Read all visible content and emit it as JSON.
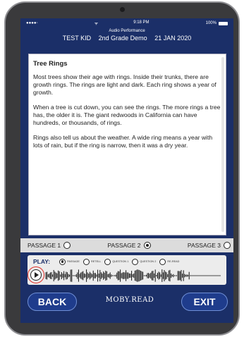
{
  "status_bar": {
    "signal": "●●●●◦",
    "wifi": "ᯤ",
    "time": "9:18 PM",
    "battery_pct": "100%"
  },
  "header": {
    "subtitle": "Audio Performance",
    "student": "TEST KID",
    "demo": "2nd Grade Demo",
    "date": "21 JAN 2020"
  },
  "passage": {
    "title": "Tree Rings",
    "paragraphs": [
      "Most trees show their age with rings. Inside their trunks, there are growth rings. The rings are light and dark. Each ring shows a year of growth.",
      "When a tree is cut down, you can see the rings. The more rings a tree has, the older it is. The giant redwoods in California can have hundreds, or thousands, of rings.",
      "Rings also tell us about the weather. A wide ring means a year with lots of rain, but if the ring is narrow, then it was a dry year."
    ]
  },
  "passage_selector": [
    {
      "label": "PASSAGE 1",
      "selected": false
    },
    {
      "label": "PASSAGE 2",
      "selected": true
    },
    {
      "label": "PASSAGE 3",
      "selected": false
    }
  ],
  "play": {
    "label": "PLAY:",
    "options": [
      {
        "label": "PASSAGE",
        "selected": true
      },
      {
        "label": "RETELL",
        "selected": false
      },
      {
        "label": "QUESTION 1",
        "selected": false
      },
      {
        "label": "QUESTION 2",
        "selected": false
      },
      {
        "label": "RE-READ",
        "selected": false
      }
    ]
  },
  "footer": {
    "back_label": "BACK",
    "logo_text": "MOBY.READ",
    "exit_label": "EXIT"
  },
  "colors": {
    "screen_bg": "#1b2f68",
    "button_bg": "#1f3c8c",
    "highlight": "#e0302a"
  }
}
